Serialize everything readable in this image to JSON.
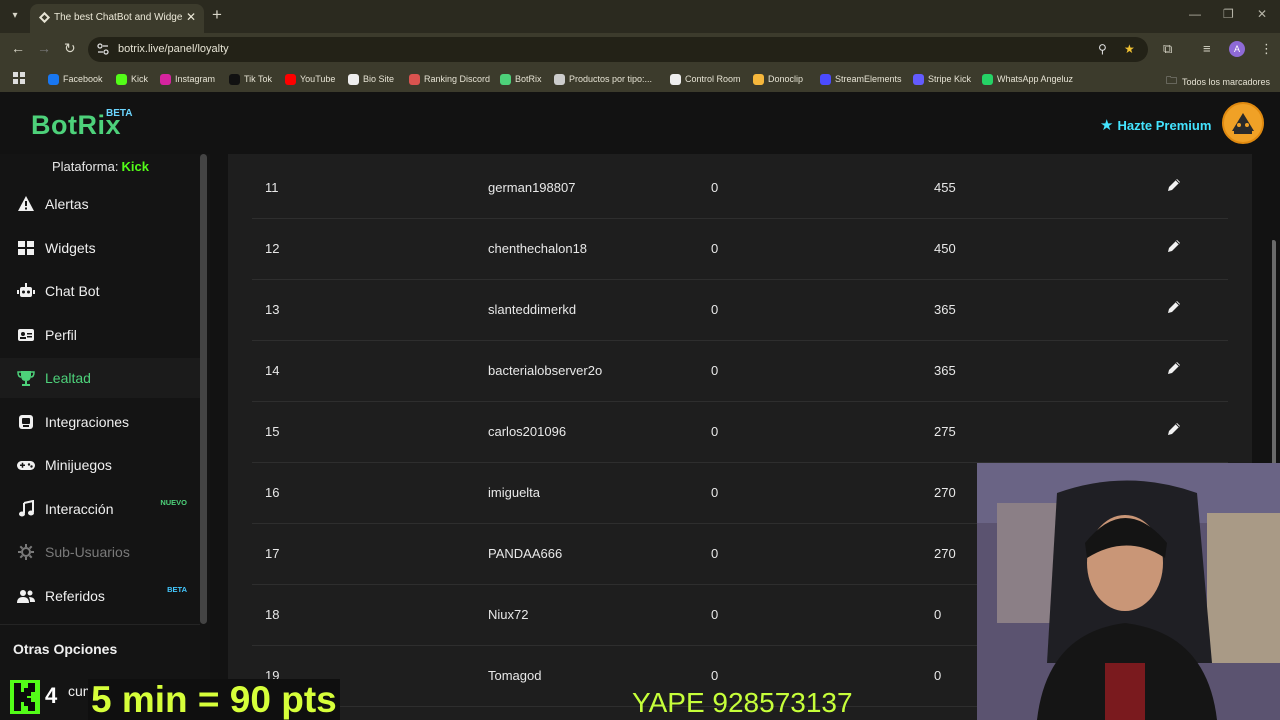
{
  "browser": {
    "tab_title": "The best ChatBot and Widgets",
    "url": "botrix.live/panel/loyalty",
    "profile_initial": "A",
    "bookmarks": [
      {
        "label": "Facebook",
        "icon": "facebook-icon",
        "color": "#1877f2"
      },
      {
        "label": "Kick",
        "icon": "kick-icon",
        "color": "#53fc18"
      },
      {
        "label": "Instagram",
        "icon": "instagram-icon",
        "color": "#d6249f"
      },
      {
        "label": "Tik Tok",
        "icon": "tiktok-icon",
        "color": "#111111"
      },
      {
        "label": "YouTube",
        "icon": "youtube-icon",
        "color": "#ff0000"
      },
      {
        "label": "Bio Site",
        "icon": "biosite-icon",
        "color": "#eeeeee"
      },
      {
        "label": "Ranking Discord",
        "icon": "ranking-icon",
        "color": "#d9534f"
      },
      {
        "label": "BotRix",
        "icon": "botrix-icon",
        "color": "#4dd17a"
      },
      {
        "label": "Productos por tipo:...",
        "icon": "document-icon",
        "color": "#cccccc"
      },
      {
        "label": "Control Room",
        "icon": "control-room-icon",
        "color": "#eeeeee"
      },
      {
        "label": "Donoclip",
        "icon": "donoclip-icon",
        "color": "#f6b73c"
      },
      {
        "label": "StreamElements",
        "icon": "streamelements-icon",
        "color": "#4b4bff"
      },
      {
        "label": "Stripe Kick",
        "icon": "stripe-icon",
        "color": "#635bff"
      },
      {
        "label": "WhatsApp Angeluz",
        "icon": "whatsapp-icon",
        "color": "#25d366"
      }
    ],
    "all_bookmarks": "Todos los marcadores"
  },
  "app": {
    "logo": "BotRix",
    "logo_badge": "BETA",
    "premium": "Hazte Premium",
    "platform_label": "Plataforma:",
    "platform_value": "Kick",
    "nav": [
      {
        "label": "Alertas",
        "icon": "alert-icon"
      },
      {
        "label": "Widgets",
        "icon": "widgets-icon"
      },
      {
        "label": "Chat Bot",
        "icon": "robot-icon"
      },
      {
        "label": "Perfil",
        "icon": "profile-card-icon"
      },
      {
        "label": "Lealtad",
        "icon": "trophy-icon",
        "active": true
      },
      {
        "label": "Integraciones",
        "icon": "integrations-icon"
      },
      {
        "label": "Minijuegos",
        "icon": "gamepad-icon"
      },
      {
        "label": "Interacción",
        "icon": "music-icon",
        "badge": "NUEVO"
      },
      {
        "label": "Sub-Usuarios",
        "icon": "sub-users-icon",
        "dim": true
      },
      {
        "label": "Referidos",
        "icon": "users-icon",
        "badge": "BETA"
      }
    ],
    "other_options": "Otras Opciones",
    "other_item_partial": "cum"
  },
  "table": {
    "rows": [
      {
        "rank": "11",
        "user": "german198807",
        "col3": "0",
        "points": "455"
      },
      {
        "rank": "12",
        "user": "chenthechalon18",
        "col3": "0",
        "points": "450"
      },
      {
        "rank": "13",
        "user": "slanteddimerkd",
        "col3": "0",
        "points": "365"
      },
      {
        "rank": "14",
        "user": "bacterialobserver2o",
        "col3": "0",
        "points": "365"
      },
      {
        "rank": "15",
        "user": "carlos201096",
        "col3": "0",
        "points": "275"
      },
      {
        "rank": "16",
        "user": "imiguelta",
        "col3": "0",
        "points": "270"
      },
      {
        "rank": "17",
        "user": "PANDAA666",
        "col3": "0",
        "points": "270"
      },
      {
        "rank": "18",
        "user": "Niux72",
        "col3": "0",
        "points": "0"
      },
      {
        "rank": "19",
        "user": "Tomagod",
        "col3": "0",
        "points": "0"
      }
    ]
  },
  "overlay": {
    "kick_count": "4",
    "promo": "5 min = 90 pts",
    "yape": "YAPE 928573137"
  }
}
